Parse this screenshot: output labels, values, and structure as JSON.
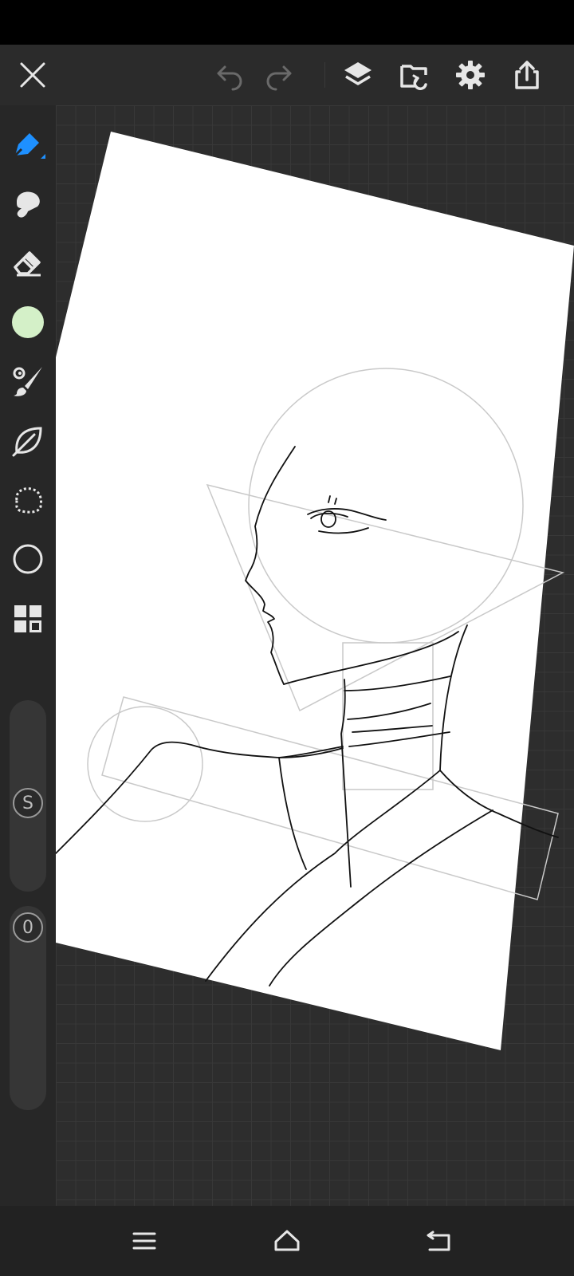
{
  "app": {
    "name": "Drawing canvas",
    "accent_color": "#1e90ff",
    "current_color": "#d4f0c8"
  },
  "toolbar": {
    "buttons": [
      "close-icon",
      "undo-icon",
      "redo-icon",
      "layers-icon",
      "import-icon",
      "settings-icon",
      "share-icon"
    ]
  },
  "sidebar": {
    "tools": [
      "brush-icon",
      "smudge-icon",
      "eraser-icon",
      "color-swatch",
      "paint-brush-icon",
      "leaf-icon",
      "lasso-icon",
      "ellipse-icon",
      "grid-icon"
    ],
    "size_slider_label": "S",
    "opacity_slider_label": "0"
  },
  "nav": {
    "buttons": [
      "menu-icon",
      "home-icon",
      "back-icon"
    ]
  }
}
